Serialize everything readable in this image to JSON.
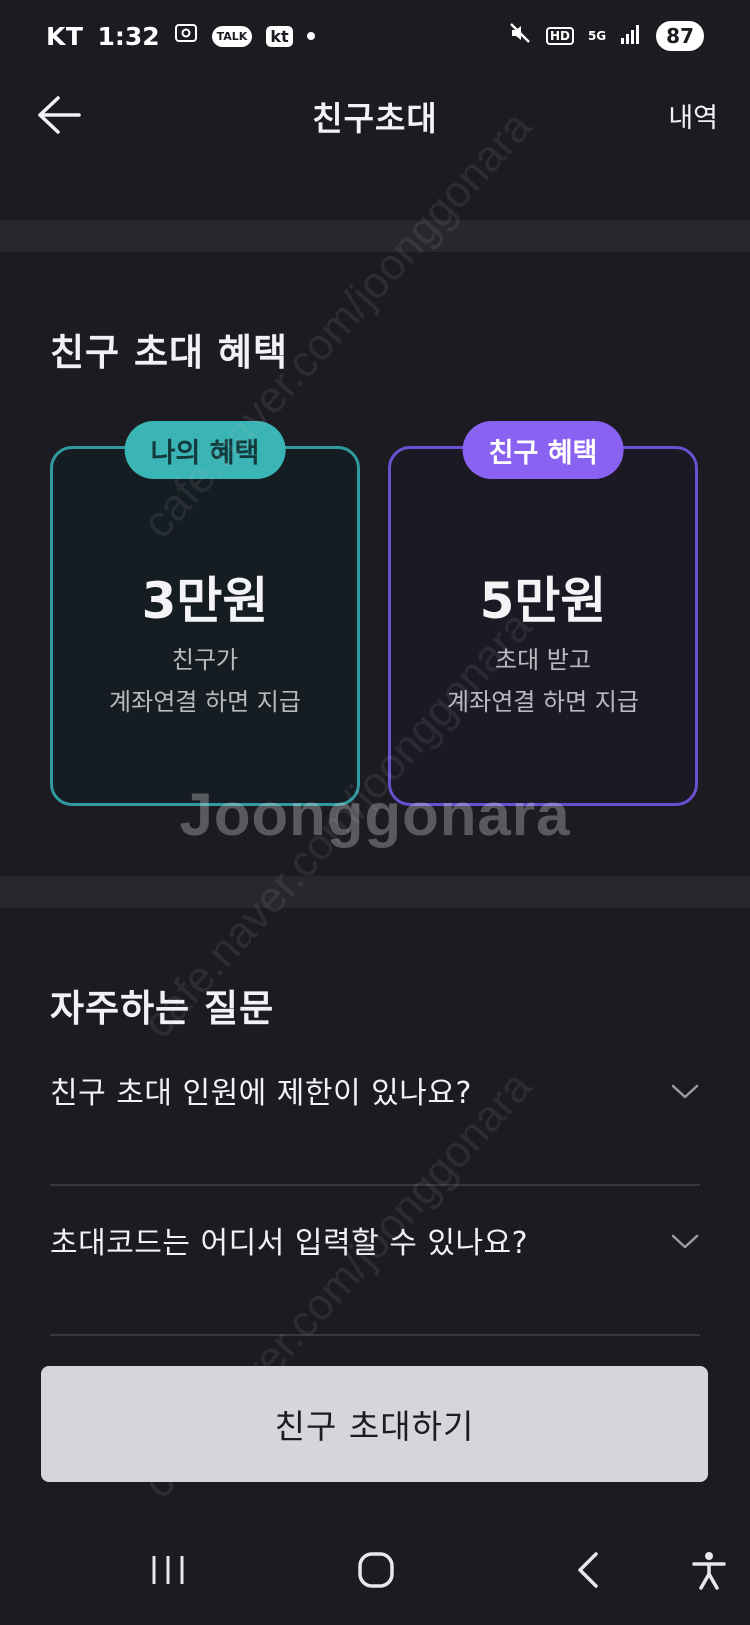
{
  "status_bar": {
    "carrier": "KT",
    "time": "1:32",
    "talk_badge": "TALK",
    "kt_badge": "kt",
    "hd_label": "HD",
    "network": "5G",
    "battery": "87"
  },
  "header": {
    "title": "친구초대",
    "history_label": "내역"
  },
  "benefits": {
    "section_title": "친구 초대 혜택",
    "mine": {
      "badge": "나의 혜택",
      "amount": "3만원",
      "desc_line1": "친구가",
      "desc_line2": "계좌연결 하면 지급"
    },
    "friend": {
      "badge": "친구 혜택",
      "amount": "5만원",
      "desc_line1": "초대 받고",
      "desc_line2": "계좌연결 하면 지급"
    }
  },
  "faq": {
    "section_title": "자주하는 질문",
    "items": [
      {
        "question": "친구 초대 인원에 제한이 있나요?"
      },
      {
        "question": "초대코드는 어디서 입력할 수 있나요?"
      }
    ]
  },
  "cta": {
    "invite_label": "친구 초대하기"
  },
  "watermark": {
    "brand": "Joonggonara",
    "url": "cafe.naver.com/joonggonara"
  },
  "colors": {
    "background": "#1c1b21",
    "mine_accent": "#3ab4b4",
    "friend_accent": "#8a62f2",
    "button_bg": "#d6d5da"
  },
  "icons": {
    "back": "arrow-left-icon",
    "chevron": "chevron-down-icon",
    "nav_recent": "recent-apps-icon",
    "nav_home": "home-icon",
    "nav_back": "nav-back-icon",
    "accessibility": "accessibility-icon"
  }
}
